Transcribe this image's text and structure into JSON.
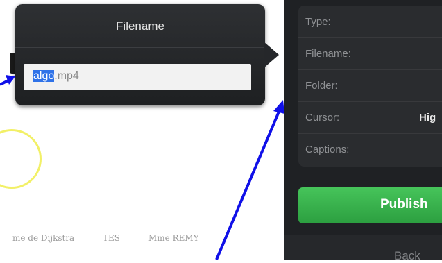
{
  "popover": {
    "title": "Filename",
    "field": {
      "selected_text": "algo",
      "rest_text": ".mp4"
    }
  },
  "background": {
    "links": [
      "me de Dijkstra",
      "TES",
      "Mme REMY"
    ]
  },
  "panel": {
    "rows": [
      {
        "label": "Type:",
        "value": ""
      },
      {
        "label": "Filename:",
        "value": ""
      },
      {
        "label": "Folder:",
        "value": ""
      },
      {
        "label": "Cursor:",
        "value": "Hig"
      },
      {
        "label": "Captions:",
        "value": ""
      }
    ],
    "publish_label": "Publish",
    "back_label": "Back"
  },
  "colors": {
    "annotation_arrow": "#1010e8",
    "publish_green": "#34b04a",
    "selection": "#2f72e8"
  }
}
